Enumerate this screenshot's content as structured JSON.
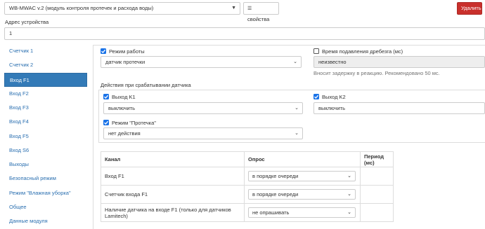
{
  "device": {
    "selected": "WB-MWAC v.2 (модуль контроля протечек и расхода воды)",
    "properties_label": "свойства",
    "delete_label": "Удалить"
  },
  "address": {
    "label": "Адрес устройства",
    "value": "1"
  },
  "sidebar": {
    "items": [
      {
        "label": "Счетчик 1"
      },
      {
        "label": "Счетчик 2"
      },
      {
        "label": "Вход F1"
      },
      {
        "label": "Вход F2"
      },
      {
        "label": "Вход F3"
      },
      {
        "label": "Вход F4"
      },
      {
        "label": "Вход F5"
      },
      {
        "label": "Вход S6"
      },
      {
        "label": "Выходы"
      },
      {
        "label": "Безопасный режим"
      },
      {
        "label": "Режим \"Влажная уборка\""
      },
      {
        "label": "Общее"
      },
      {
        "label": "Данные модуля"
      }
    ],
    "active_index": 2
  },
  "main": {
    "mode": {
      "label": "Режим работы",
      "checked": true,
      "value": "датчик протечки"
    },
    "debounce": {
      "label": "Время подавления дребезга (мс)",
      "checked": false,
      "value": "неизвестно",
      "hint": "Вносит задержку в реакцию. Рекомендовано 50 мс."
    },
    "actions_title": "Действия при срабатывании датчика",
    "out_k1": {
      "label": "Выход K1",
      "checked": true,
      "value": "выключить"
    },
    "out_k2": {
      "label": "Выход K2",
      "checked": true,
      "value": "выключить"
    },
    "leak_mode": {
      "label": "Режим \"Протечка\"",
      "checked": true,
      "value": "нет действия"
    },
    "table": {
      "headers": [
        "Канал",
        "Опрос",
        "Период (мс)"
      ],
      "rows": [
        {
          "channel": "Вход F1",
          "poll": "в порядке очереди",
          "period": ""
        },
        {
          "channel": "Счетчик входа F1",
          "poll": "в порядке очереди",
          "period": ""
        },
        {
          "channel": "Наличие датчика на входе F1 (только для датчиков Lamitech)",
          "poll": "не опрашивать",
          "period": ""
        }
      ]
    }
  },
  "colors": {
    "accent": "#337ab7",
    "checkbox": "#1a73e8",
    "danger": "#c9302c"
  }
}
